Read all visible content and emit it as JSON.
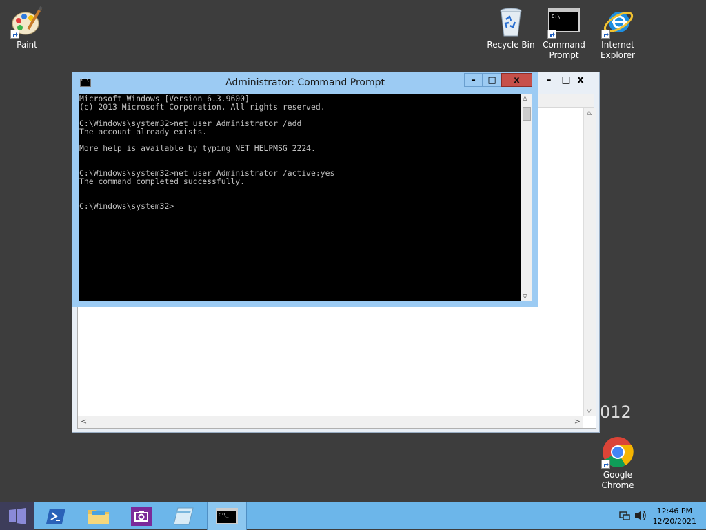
{
  "desktop": {
    "icons": {
      "paint": "Paint",
      "recycle_bin": "Recycle Bin",
      "command_prompt_line1": "Command",
      "command_prompt_line2": "Prompt",
      "internet_explorer_line1": "Internet",
      "internet_explorer_line2": "Explorer",
      "google_chrome_line1": "Google",
      "google_chrome_line2": "Chrome"
    },
    "watermark_fragment": "012"
  },
  "cmd_window": {
    "title": "Administrator: Command Prompt",
    "icon_text": "C:\\",
    "minimize": "–",
    "maximize": "□",
    "close": "x",
    "console_lines": [
      "Microsoft Windows [Version 6.3.9600]",
      "(c) 2013 Microsoft Corporation. All rights reserved.",
      "",
      "C:\\Windows\\system32>net user Administrator /add",
      "The account already exists.",
      "",
      "More help is available by typing NET HELPMSG 2224.",
      "",
      "",
      "C:\\Windows\\system32>net user Administrator /active:yes",
      "The command completed successfully.",
      "",
      "",
      "C:\\Windows\\system32>"
    ]
  },
  "bg_window": {
    "minimize": "–",
    "maximize": "□",
    "close": "x"
  },
  "taskbar": {
    "clock_time": "12:46 PM",
    "clock_date": "12/20/2021"
  }
}
